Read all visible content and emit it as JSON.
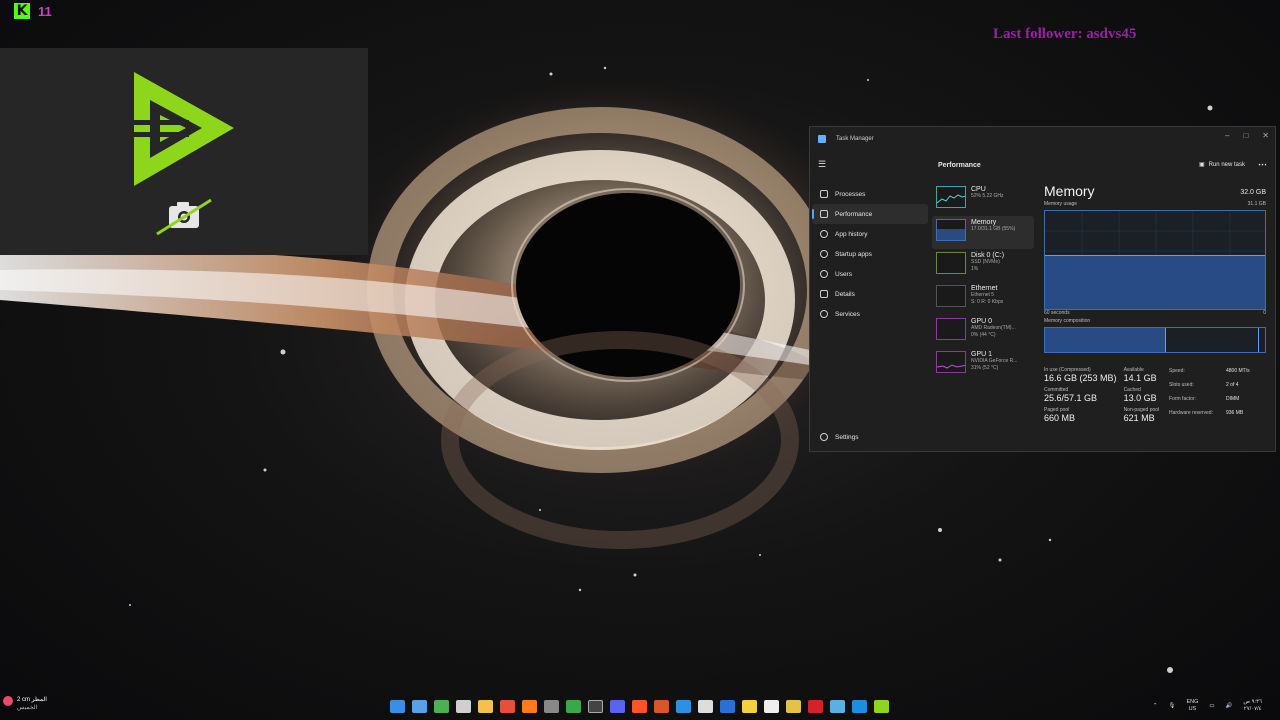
{
  "overlay": {
    "kick_logo": "K",
    "viewer_count": "11",
    "last_follower": "Last follower: asdvs45"
  },
  "task_manager": {
    "window_title": "Task Manager",
    "header_title": "Performance",
    "run_new_task": "Run new task",
    "nav": [
      {
        "label": "Processes"
      },
      {
        "label": "Performance"
      },
      {
        "label": "App history"
      },
      {
        "label": "Startup apps"
      },
      {
        "label": "Users"
      },
      {
        "label": "Details"
      },
      {
        "label": "Services"
      }
    ],
    "settings_label": "Settings",
    "resources": [
      {
        "name": "CPU",
        "sub1": "52%  5.22 GHz",
        "sub2": ""
      },
      {
        "name": "Memory",
        "sub1": "17.0/31.1 GB (55%)",
        "sub2": ""
      },
      {
        "name": "Disk 0 (C:)",
        "sub1": "SSD (NVMe)",
        "sub2": "1%"
      },
      {
        "name": "Ethernet",
        "sub1": "Ethernet 5",
        "sub2": "S: 0  R: 0 Kbps"
      },
      {
        "name": "GPU 0",
        "sub1": "AMD Radeon(TM)...",
        "sub2": "0% (44 °C)"
      },
      {
        "name": "GPU 1",
        "sub1": "NVIDIA GeForce R...",
        "sub2": "31% (52 °C)"
      }
    ],
    "memory": {
      "title": "Memory",
      "total": "32.0 GB",
      "usage_label": "Memory usage",
      "usage_max": "31.1 GB",
      "time_label": "60 seconds",
      "time_end": "0",
      "composition_label": "Memory composition",
      "usage_fraction": 0.55,
      "stats": {
        "in_use_label": "In use (Compressed)",
        "in_use": "16.6 GB (253 MB)",
        "available_label": "Available",
        "available": "14.1 GB",
        "committed_label": "Committed",
        "committed": "25.6/57.1 GB",
        "cached_label": "Cached",
        "cached": "13.0 GB",
        "paged_label": "Paged pool",
        "paged": "660 MB",
        "nonpaged_label": "Non-paged pool",
        "nonpaged": "621 MB"
      },
      "props": {
        "speed_label": "Speed:",
        "speed": "4800 MT/s",
        "slots_label": "Slots used:",
        "slots": "2 of 4",
        "form_label": "Form factor:",
        "form": "DIMM",
        "reserved_label": "Hardware reserved:",
        "reserved": "936 MB"
      }
    }
  },
  "taskbar": {
    "weather_temp": "2 cm المطر",
    "weather_day": "الخميس",
    "lang_1": "ENG",
    "lang_2": "US",
    "clock_time": "٩:٣٦ ص",
    "clock_date": "٢٧/٠٧/٤"
  },
  "colors": {
    "accent_blue": "#4aa8ff",
    "kick_green": "#53fc18",
    "follower_purple": "#9c1fa6",
    "logo_green": "#8ed61c"
  }
}
